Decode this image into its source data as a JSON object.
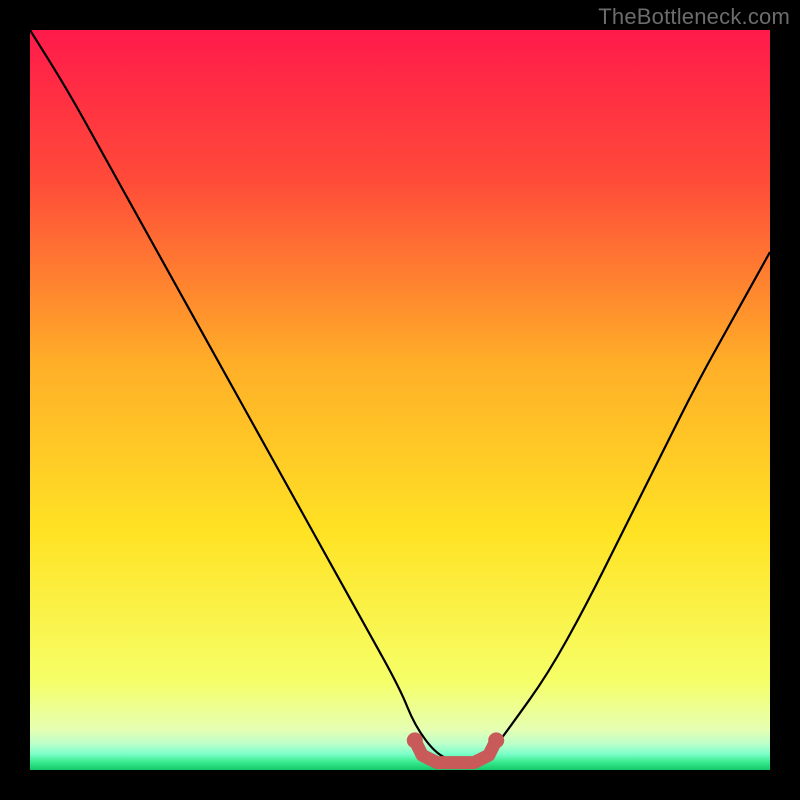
{
  "watermark": "TheBottleneck.com",
  "colors": {
    "frame": "#000000",
    "gradient_stops": [
      {
        "offset": 0.0,
        "color": "#ff1a4b"
      },
      {
        "offset": 0.2,
        "color": "#ff4a39"
      },
      {
        "offset": 0.45,
        "color": "#ffae28"
      },
      {
        "offset": 0.68,
        "color": "#ffe324"
      },
      {
        "offset": 0.88,
        "color": "#f6ff68"
      },
      {
        "offset": 0.945,
        "color": "#e6ffb2"
      },
      {
        "offset": 0.965,
        "color": "#baffca"
      },
      {
        "offset": 0.978,
        "color": "#7dffc9"
      },
      {
        "offset": 0.99,
        "color": "#35e98d"
      },
      {
        "offset": 1.0,
        "color": "#16c86a"
      }
    ],
    "curve": "#000000",
    "marker": "#c95a5a"
  },
  "chart_data": {
    "type": "line",
    "title": "",
    "xlabel": "",
    "ylabel": "",
    "xlim": [
      0,
      100
    ],
    "ylim": [
      0,
      100
    ],
    "series": [
      {
        "name": "bottleneck-curve",
        "x": [
          0,
          5,
          10,
          15,
          20,
          25,
          30,
          35,
          40,
          45,
          50,
          52,
          55,
          58,
          60,
          62,
          65,
          70,
          75,
          80,
          85,
          90,
          95,
          100
        ],
        "y": [
          100,
          92,
          83,
          74,
          65,
          56,
          47,
          38,
          29,
          20,
          11,
          6,
          2,
          1,
          1,
          2,
          6,
          13,
          22,
          32,
          42,
          52,
          61,
          70
        ]
      }
    ],
    "markers": {
      "name": "highlight-band",
      "x": [
        52,
        53,
        54,
        55,
        56,
        57,
        58,
        59,
        60,
        61,
        62,
        63
      ],
      "y": [
        4,
        2,
        1.5,
        1,
        1,
        1,
        1,
        1,
        1,
        1.5,
        2,
        4
      ]
    }
  }
}
